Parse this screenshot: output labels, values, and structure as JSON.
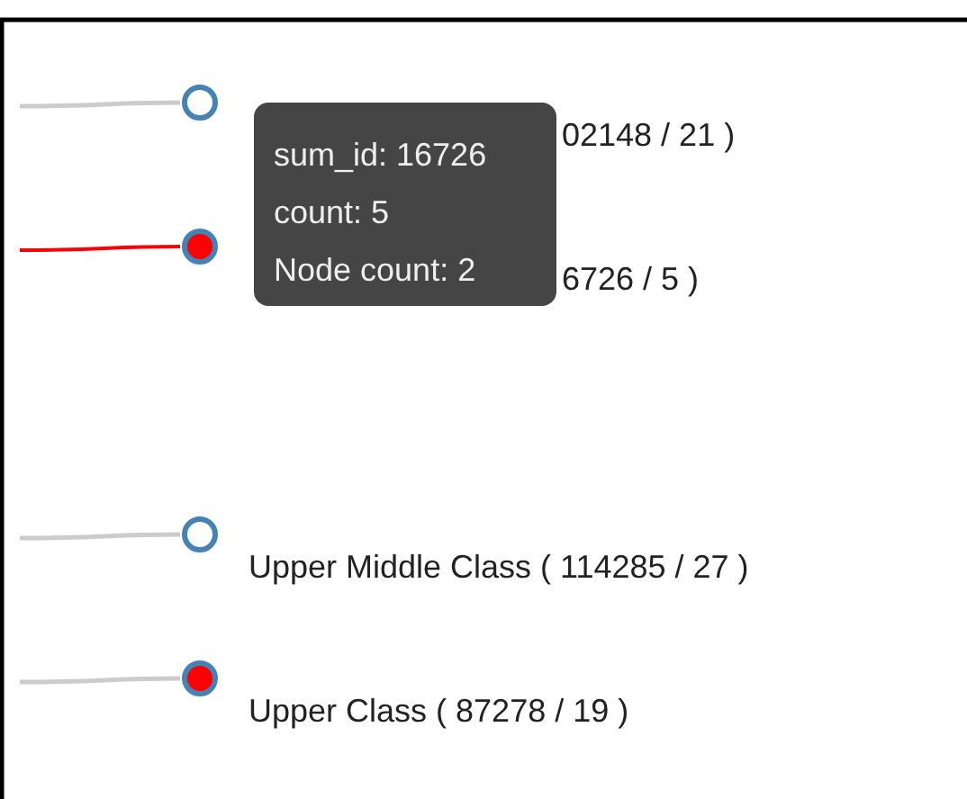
{
  "nodes": [
    {
      "label": "02148 / 21 )",
      "kind": "covered",
      "collapsed": false,
      "link_highlighted": false
    },
    {
      "label": "6726 / 5 )",
      "kind": "covered",
      "collapsed": true,
      "link_highlighted": true
    },
    {
      "label": "Upper Middle Class ( 114285 / 27 )",
      "collapsed": false,
      "link_highlighted": false
    },
    {
      "label": "Upper Class ( 87278 / 19 )",
      "collapsed": true,
      "link_highlighted": false
    }
  ],
  "tooltip": {
    "lines": [
      "sum_id: 16726",
      "count: 5",
      "Node count: 2"
    ]
  }
}
